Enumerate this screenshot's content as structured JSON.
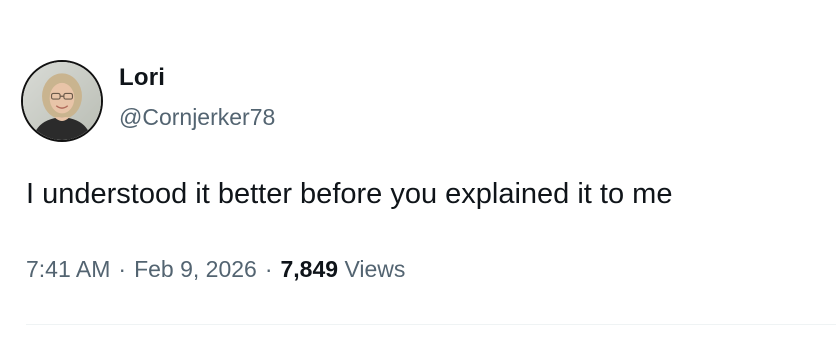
{
  "author": {
    "display_name": "Lori",
    "handle": "@Cornjerker78"
  },
  "tweet": {
    "text": "I understood it better before you explained it to me"
  },
  "meta": {
    "time": "7:41 AM",
    "separator": "·",
    "date": "Feb 9, 2026",
    "views_count": "7,849",
    "views_label": "Views"
  },
  "colors": {
    "text_primary": "#0f1419",
    "text_secondary": "#536471",
    "divider": "#eff3f4"
  }
}
